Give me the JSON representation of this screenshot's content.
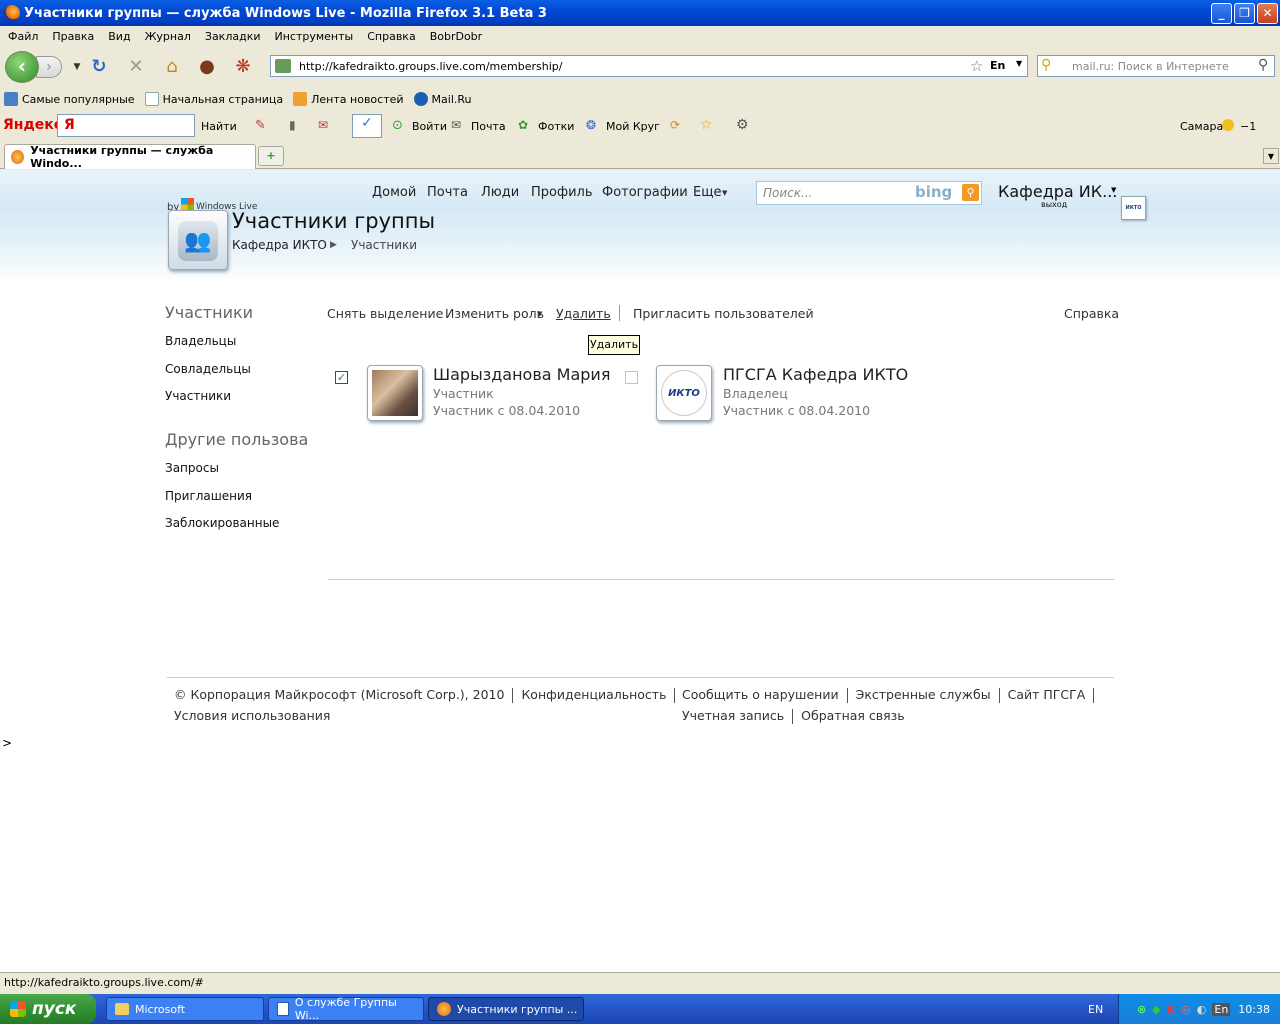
{
  "window": {
    "title": "Участники группы — служба Windows Live - Mozilla Firefox 3.1 Beta 3"
  },
  "menu": [
    "Файл",
    "Правка",
    "Вид",
    "Журнал",
    "Закладки",
    "Инструменты",
    "Справка",
    "BobrDobr"
  ],
  "address": {
    "url": "http://kafedraikto.groups.live.com/membership/",
    "lang": "En",
    "search_placeholder": "mail.ru: Поиск в Интернете"
  },
  "bookmarks": [
    "Самые популярные",
    "Начальная страница",
    "Лента новостей",
    "Mail.Ru"
  ],
  "yandex": {
    "logo": "Яндекс",
    "find": "Найти",
    "login": "Войти",
    "mail": "Почта",
    "photos": "Фотки",
    "circle": "Мой Круг",
    "city": "Самара",
    "temp": "−1"
  },
  "tab": {
    "title": "Участники группы — служба Windo..."
  },
  "site": {
    "nav": [
      "Домой",
      "Почта",
      "Люди",
      "Профиль",
      "Фотографии",
      "Еще"
    ],
    "search_placeholder": "Поиск...",
    "bing": "bing",
    "user_name": "Кафедра ИК...",
    "user_logout": "выход",
    "by_label": "by",
    "windows_live": "Windows Live",
    "page_title": "Участники группы",
    "breadcrumb": [
      "Кафедра ИКТО",
      "Участники"
    ]
  },
  "sidebar": {
    "section1": "Участники",
    "items1": [
      "Владельцы",
      "Совладельцы",
      "Участники"
    ],
    "section2": "Другие пользовате",
    "items2": [
      "Запросы",
      "Приглашения",
      "Заблокированные"
    ]
  },
  "actions": {
    "deselect": "Снять выделение",
    "change_role": "Изменить роль",
    "delete": "Удалить",
    "invite": "Пригласить пользователей",
    "help": "Справка",
    "tooltip": "Удалить"
  },
  "members": [
    {
      "name": "Шарызданова Мария",
      "role": "Участник",
      "since": "Участник с 08.04.2010",
      "checked": true
    },
    {
      "name": "ПГСГА Кафедра ИКТО",
      "role": "Владелец",
      "since": "Участник с 08.04.2010",
      "checked": false,
      "logo": "ИКТО"
    }
  ],
  "footer": {
    "copyright": "© Корпорация Майкрософт (Microsoft Corp.), 2010",
    "privacy": "Конфиденциальность",
    "terms": "Условия использования",
    "report": "Сообщить о нарушении",
    "emergency": "Экстренные службы",
    "site": "Сайт ПГСГА",
    "account": "Учетная запись",
    "feedback": "Обратная связь"
  },
  "stray_char": ">",
  "status": "http://kafedraikto.groups.live.com/#",
  "taskbar": {
    "start": "пуск",
    "tasks": [
      "Microsoft",
      "О службе Группы Wi...",
      "Участники группы ..."
    ],
    "lang": "EN",
    "tray_lang": "En",
    "clock": "10:38"
  }
}
